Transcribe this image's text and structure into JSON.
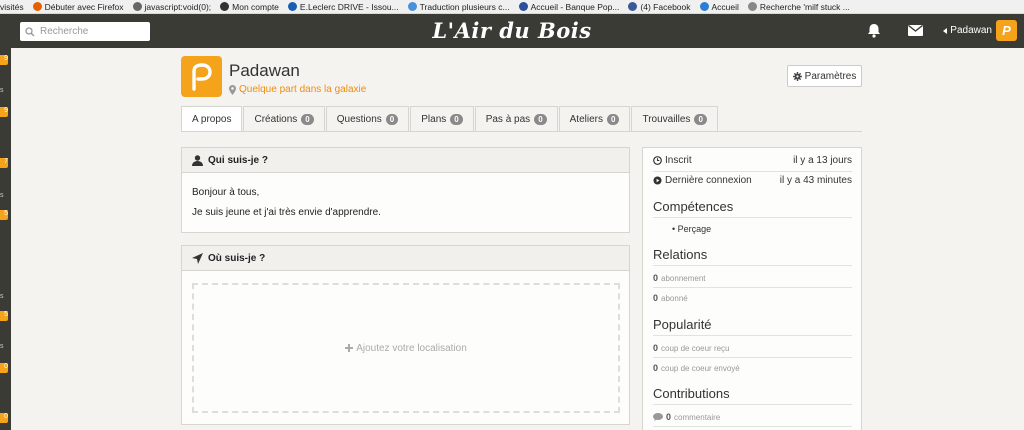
{
  "bookmarks": [
    {
      "label": "visités",
      "color": "#888"
    },
    {
      "label": "Débuter avec Firefox",
      "color": "#e66000"
    },
    {
      "label": "javascript:void(0);",
      "color": "#666"
    },
    {
      "label": "Mon compte",
      "color": "#333"
    },
    {
      "label": "E.Leclerc DRIVE - Issou...",
      "color": "#1a5db3"
    },
    {
      "label": "Traduction plusieurs c...",
      "color": "#4a90d9"
    },
    {
      "label": "Accueil - Banque Pop...",
      "color": "#2a4e9c"
    },
    {
      "label": "(4) Facebook",
      "color": "#3b5998"
    },
    {
      "label": "Accueil",
      "color": "#2a7dd1"
    },
    {
      "label": "Recherche 'milf stuck ...",
      "color": "#888"
    }
  ],
  "header": {
    "search_placeholder": "Recherche",
    "logo": "L'Air du Bois",
    "user": "Padawan",
    "avatar_letter": "P"
  },
  "profile": {
    "name": "Padawan",
    "location": "Quelque part dans la galaxie",
    "settings": "Paramètres"
  },
  "tabs": [
    {
      "label": "A propos",
      "count": null
    },
    {
      "label": "Créations",
      "count": "0"
    },
    {
      "label": "Questions",
      "count": "0"
    },
    {
      "label": "Plans",
      "count": "0"
    },
    {
      "label": "Pas à pas",
      "count": "0"
    },
    {
      "label": "Ateliers",
      "count": "0"
    },
    {
      "label": "Trouvailles",
      "count": "0"
    }
  ],
  "about": {
    "title": "Qui suis-je ?",
    "line1": "Bonjour à tous,",
    "line2": "Je suis jeune et j'ai très envie d'apprendre."
  },
  "where": {
    "title": "Où suis-je ?",
    "add": "Ajoutez votre localisation"
  },
  "sidebar": {
    "joined_label": "Inscrit",
    "joined_value": "il y a 13 jours",
    "last_label": "Dernière connexion",
    "last_value": "il y a 43 minutes",
    "skills_title": "Compétences",
    "skill": "Perçage",
    "relations_title": "Relations",
    "sub_count": "0",
    "sub_label": "abonnement",
    "fol_count": "0",
    "fol_label": "abonné",
    "pop_title": "Popularité",
    "like_count": "0",
    "like_label": "coup de coeur reçu",
    "sent_count": "0",
    "sent_label": "coup de coeur envoyé",
    "contrib_title": "Contributions",
    "com_count": "0",
    "com_label": "commentaire"
  },
  "strip_badges": [
    "9",
    "9",
    "7",
    "5",
    "5",
    "0",
    "0"
  ],
  "strip_letters": [
    "s",
    "s",
    "s",
    "s"
  ],
  "colors": {
    "accent": "#f5a31a",
    "header_bg": "#3b3b36",
    "link": "#f08c10"
  }
}
